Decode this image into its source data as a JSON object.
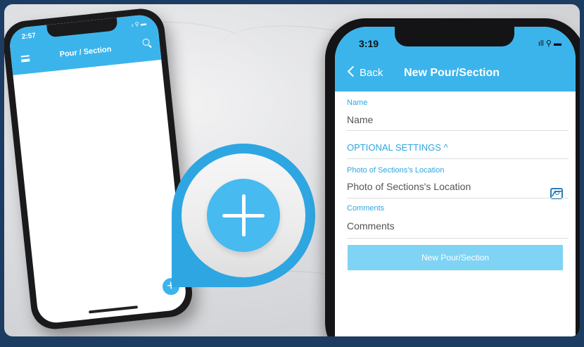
{
  "left_phone": {
    "time": "2:57",
    "status_icons": "ᵢₗ ⚲ ▬",
    "title": "Pour / Section",
    "fab_symbol": "+"
  },
  "right_phone": {
    "time": "3:19",
    "status_icons": "ıll ⚲ ▬",
    "back_label": "Back",
    "title": "New Pour/Section",
    "fields": {
      "name_label": "Name",
      "name_placeholder": "Name",
      "optional_settings": "OPTIONAL SETTINGS ^",
      "photo_label": "Photo of Sections's Location",
      "photo_placeholder": "Photo of Sections's Location",
      "comments_label": "Comments",
      "comments_placeholder": "Comments"
    },
    "submit_label": "New Pour/Section"
  },
  "colors": {
    "header_blue": "#3bb4ec",
    "accent_blue": "#2ea6e2",
    "submit_disabled": "#7fd3f4",
    "frame_navy": "#1d3c61"
  }
}
